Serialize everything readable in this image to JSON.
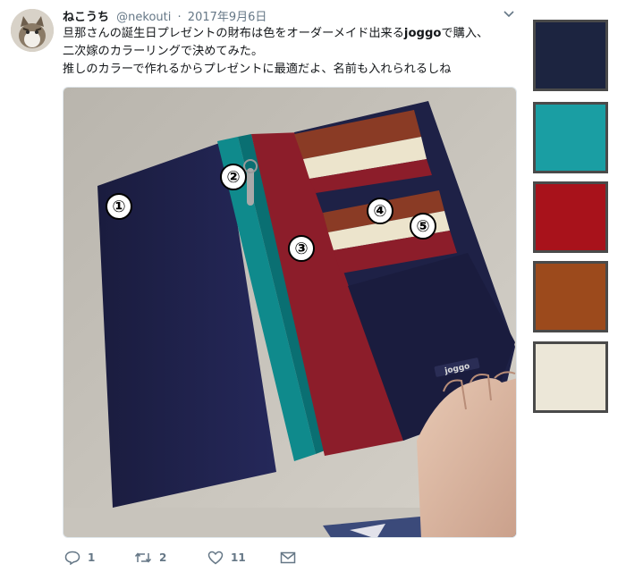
{
  "tweet": {
    "display_name": "ねこうち",
    "handle": "@nekouti",
    "separator": "·",
    "date": "2017年9月6日",
    "line1_before": "旦那さんの誕生日プレゼントの財布は色をオーダーメイド出来る",
    "line1_bold": "joggo",
    "line1_after": "で購入、",
    "line2": "二次嫁のカラーリングで決めてみた。",
    "line3": "推しのカラーで作れるからプレゼントに最適だよ、名前も入れられるしね",
    "photo_labels": [
      "①",
      "②",
      "③",
      "④",
      "⑤"
    ],
    "brand_logo_text": "joggo",
    "actions": {
      "reply_count": "1",
      "retweet_count": "2",
      "like_count": "11"
    }
  },
  "swatches": [
    {
      "name": "navy",
      "color": "#1c2440"
    },
    {
      "name": "teal",
      "color": "#1a9ea3"
    },
    {
      "name": "red",
      "color": "#a8121b"
    },
    {
      "name": "brown",
      "color": "#9c4a1c"
    },
    {
      "name": "cream",
      "color": "#ece7d8"
    }
  ],
  "colors": {
    "wallet_navy": "#1f2145",
    "wallet_teal": "#0f8a8c",
    "wallet_red": "#8c1d2a",
    "wallet_brown": "#8a3b25",
    "wallet_cream": "#ece4cc",
    "icon_gray": "#657786"
  }
}
